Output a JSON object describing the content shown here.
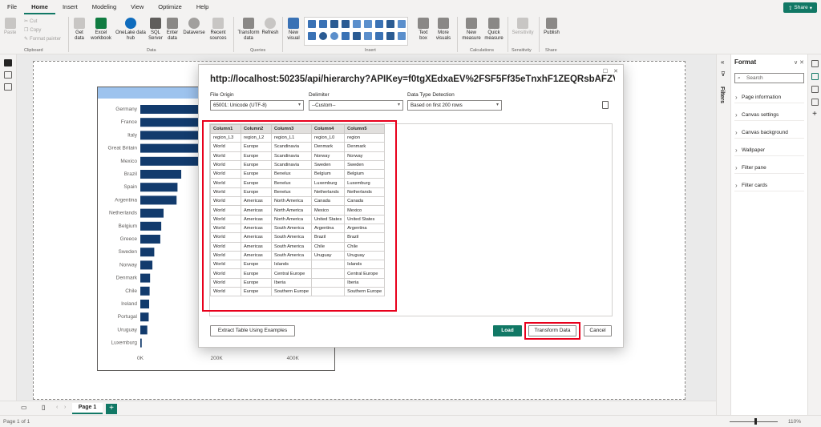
{
  "menu": {
    "items": [
      "File",
      "Home",
      "Insert",
      "Modeling",
      "View",
      "Optimize",
      "Help"
    ],
    "share": "Share"
  },
  "ribbon": {
    "clipboard": {
      "paste": "Paste",
      "cut": "Cut",
      "copy": "Copy",
      "format_painter": "Format painter",
      "label": "Clipboard"
    },
    "data": {
      "get_data": "Get data",
      "excel": "Excel workbook",
      "onelake": "OneLake data hub",
      "sql": "SQL Server",
      "enter": "Enter data",
      "dataverse": "Dataverse",
      "recent": "Recent sources",
      "label": "Data"
    },
    "queries": {
      "transform": "Transform data",
      "refresh": "Refresh",
      "label": "Queries"
    },
    "insert": {
      "new_visual": "New visual",
      "text_box": "Text box",
      "more_visuals": "More visuals",
      "label": "Insert"
    },
    "calculations": {
      "new_measure": "New measure",
      "quick_measure": "Quick measure",
      "label": "Calculations"
    },
    "sensitivity": {
      "btn": "Sensitivity",
      "label": "Sensitivity"
    },
    "share": {
      "publish": "Publish",
      "label": "Share"
    }
  },
  "format_pane": {
    "title": "Format",
    "search_placeholder": "Search",
    "items": [
      "Page information",
      "Canvas settings",
      "Canvas background",
      "Wallpaper",
      "Filter pane",
      "Filter cards"
    ]
  },
  "filters_label": "Filters",
  "page_tabs": {
    "page1": "Page 1",
    "add": "+"
  },
  "status": {
    "page": "Page 1 of 1",
    "zoom": "110%"
  },
  "chart_data": {
    "type": "bar",
    "title": "Sales b",
    "categories": [
      "Germany",
      "France",
      "Italy",
      "Great Britain",
      "Mexico",
      "Brazil",
      "Spain",
      "Argentina",
      "Netherlands",
      "Belgium",
      "Greece",
      "Sweden",
      "Norway",
      "Denmark",
      "Chile",
      "Ireland",
      "Portugal",
      "Uruguay",
      "Luxemburg"
    ],
    "values": [
      200000,
      200000,
      200000,
      200000,
      130000,
      88000,
      80000,
      78000,
      50000,
      45000,
      43000,
      30000,
      26000,
      21000,
      20000,
      19000,
      18000,
      15000,
      3000
    ],
    "xticks": [
      "0K",
      "200K",
      "400K"
    ],
    "xlim": [
      0,
      400000
    ],
    "bar_color": "#123b6d"
  },
  "dialog": {
    "title": "http://localhost:50235/api/hierarchy?APIKey=f0tgXEdxaEV%2FSF5Ff35eTnxhF1ZEQRsbAFZVG39%2BZ...",
    "file_origin_label": "File Origin",
    "file_origin_value": "65001: Unicode (UTF-8)",
    "delimiter_label": "Delimiter",
    "delimiter_value": "--Custom--",
    "detection_label": "Data Type Detection",
    "detection_value": "Based on first 200 rows",
    "columns": [
      "Column1",
      "Column2",
      "Column3",
      "Column4",
      "Column5"
    ],
    "rows": [
      [
        "region_L3",
        "region_L2",
        "region_L1",
        "region_L0",
        "region"
      ],
      [
        "World",
        "Europe",
        "Scandinavia",
        "Denmark",
        "Denmark"
      ],
      [
        "World",
        "Europe",
        "Scandinavia",
        "Norway",
        "Norway"
      ],
      [
        "World",
        "Europe",
        "Scandinavia",
        "Sweden",
        "Sweden"
      ],
      [
        "World",
        "Europe",
        "Benelux",
        "Belgium",
        "Belgium"
      ],
      [
        "World",
        "Europe",
        "Benelux",
        "Luxemburg",
        "Luxemburg"
      ],
      [
        "World",
        "Europe",
        "Benelux",
        "Netherlands",
        "Netherlands"
      ],
      [
        "World",
        "Americas",
        "North America",
        "Canada",
        "Canada"
      ],
      [
        "World",
        "Americas",
        "North America",
        "Mexico",
        "Mexico"
      ],
      [
        "World",
        "Americas",
        "North America",
        "United States",
        "United States"
      ],
      [
        "World",
        "Americas",
        "South America",
        "Argentina",
        "Argentina"
      ],
      [
        "World",
        "Americas",
        "South America",
        "Brazil",
        "Brazil"
      ],
      [
        "World",
        "Americas",
        "South America",
        "Chile",
        "Chile"
      ],
      [
        "World",
        "Americas",
        "South America",
        "Uruguay",
        "Uruguay"
      ],
      [
        "World",
        "Europe",
        "Islands",
        "",
        "Islands"
      ],
      [
        "World",
        "Europe",
        "Central Europe",
        "",
        "Central Europe"
      ],
      [
        "World",
        "Europe",
        "Iberia",
        "",
        "Iberia"
      ],
      [
        "World",
        "Europe",
        "Southern Europe",
        "",
        "Southern Europe"
      ]
    ],
    "extract_btn": "Extract Table Using Examples",
    "load_btn": "Load",
    "transform_btn": "Transform Data",
    "cancel_btn": "Cancel",
    "accent": "#117865",
    "highlight": "#e8001c"
  }
}
